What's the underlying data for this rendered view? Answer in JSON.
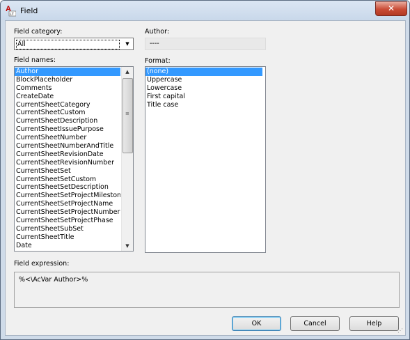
{
  "window": {
    "title": "Field",
    "close_glyph": "✕",
    "app_icon_letter": "A",
    "app_icon_sub": "LT"
  },
  "field_category": {
    "label": "Field category:",
    "value": "All"
  },
  "author": {
    "label": "Author:",
    "value": "----"
  },
  "field_names": {
    "label": "Field names:",
    "items": [
      "Author",
      "BlockPlaceholder",
      "Comments",
      "CreateDate",
      "CurrentSheetCategory",
      "CurrentSheetCustom",
      "CurrentSheetDescription",
      "CurrentSheetIssuePurpose",
      "CurrentSheetNumber",
      "CurrentSheetNumberAndTitle",
      "CurrentSheetRevisionDate",
      "CurrentSheetRevisionNumber",
      "CurrentSheetSet",
      "CurrentSheetSetCustom",
      "CurrentSheetSetDescription",
      "CurrentSheetSetProjectMilestone",
      "CurrentSheetSetProjectName",
      "CurrentSheetSetProjectNumber",
      "CurrentSheetSetProjectPhase",
      "CurrentSheetSubSet",
      "CurrentSheetTitle",
      "Date"
    ],
    "selected": "Author"
  },
  "format": {
    "label": "Format:",
    "items": [
      "(none)",
      "Uppercase",
      "Lowercase",
      "First capital",
      "Title case"
    ],
    "selected": "(none)"
  },
  "field_expression": {
    "label": "Field expression:",
    "value": "%<\\AcVar Author>%"
  },
  "buttons": {
    "ok": "OK",
    "cancel": "Cancel",
    "help": "Help"
  },
  "icons": {
    "dropdown": "dropdown-arrow-icon",
    "scroll_up": "scroll-up-arrow-icon",
    "scroll_down": "scroll-down-arrow-icon",
    "close": "close-icon",
    "app": "autocad-lt-icon"
  },
  "colors": {
    "selection": "#3399ff",
    "close_button": "#c94b35",
    "title_bar": "#cfdbe9"
  }
}
